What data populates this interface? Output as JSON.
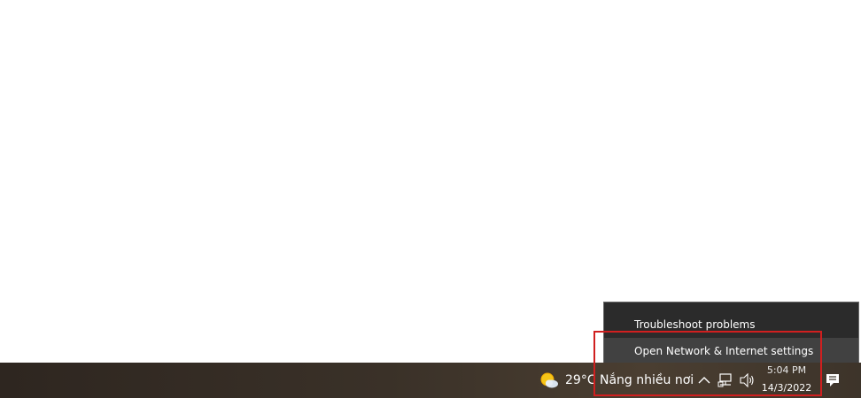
{
  "context_menu": {
    "items": [
      {
        "label": "Troubleshoot problems"
      },
      {
        "label": "Open Network & Internet settings",
        "highlighted": true
      }
    ]
  },
  "taskbar": {
    "weather": {
      "icon": "partly-sunny-icon",
      "temperature": "29°C",
      "description": "Nắng nhiều nơi"
    },
    "tray": {
      "icons": [
        "chevron-up-icon",
        "network-icon",
        "volume-icon"
      ]
    },
    "clock": {
      "time": "5:04 PM",
      "date": "14/3/2022"
    },
    "notification_icon": "notification-icon"
  },
  "annotation": {
    "highlight_color": "#d01f1f"
  }
}
